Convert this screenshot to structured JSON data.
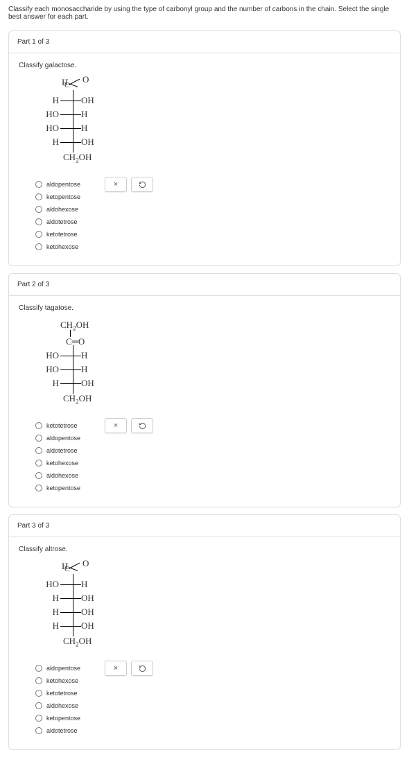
{
  "instruction": "Classify each monosaccharide by using the type of carbonyl group and the number of carbons in the chain. Select the single best answer for each part.",
  "parts": [
    {
      "header": "Part 1 of 3",
      "prompt": "Classify galactose.",
      "structure": {
        "type": "aldose",
        "top_h": "H",
        "top_o": "O",
        "top_c": "C",
        "rows": [
          {
            "left": "H",
            "right": "OH"
          },
          {
            "left": "HO",
            "right": "H"
          },
          {
            "left": "HO",
            "right": "H"
          },
          {
            "left": "H",
            "right": "OH"
          }
        ],
        "bottom": "CH₂OH"
      },
      "options": [
        "aldopentose",
        "ketopentose",
        "aldohexose",
        "aldotetrose",
        "ketotetrose",
        "ketohexose"
      ]
    },
    {
      "header": "Part 2 of 3",
      "prompt": "Classify tagatose.",
      "structure": {
        "type": "ketose",
        "top_ch2oh": "CH₂OH",
        "top_co": "C═O",
        "rows": [
          {
            "left": "HO",
            "right": "H"
          },
          {
            "left": "HO",
            "right": "H"
          },
          {
            "left": "H",
            "right": "OH"
          }
        ],
        "bottom": "CH₂OH"
      },
      "options": [
        "ketotetrose",
        "aldopentose",
        "aldotetrose",
        "ketohexose",
        "aldohexose",
        "ketopentose"
      ]
    },
    {
      "header": "Part 3 of 3",
      "prompt": "Classify altrose.",
      "structure": {
        "type": "aldose",
        "top_h": "H",
        "top_o": "O",
        "top_c": "C",
        "rows": [
          {
            "left": "HO",
            "right": "H"
          },
          {
            "left": "H",
            "right": "OH"
          },
          {
            "left": "H",
            "right": "OH"
          },
          {
            "left": "H",
            "right": "OH"
          }
        ],
        "bottom": "CH₂OH"
      },
      "options": [
        "aldopentose",
        "ketohexose",
        "ketotetrose",
        "aldohexose",
        "ketopentose",
        "aldotetrose"
      ]
    }
  ],
  "icons": {
    "close": "×",
    "reset": "↻"
  }
}
